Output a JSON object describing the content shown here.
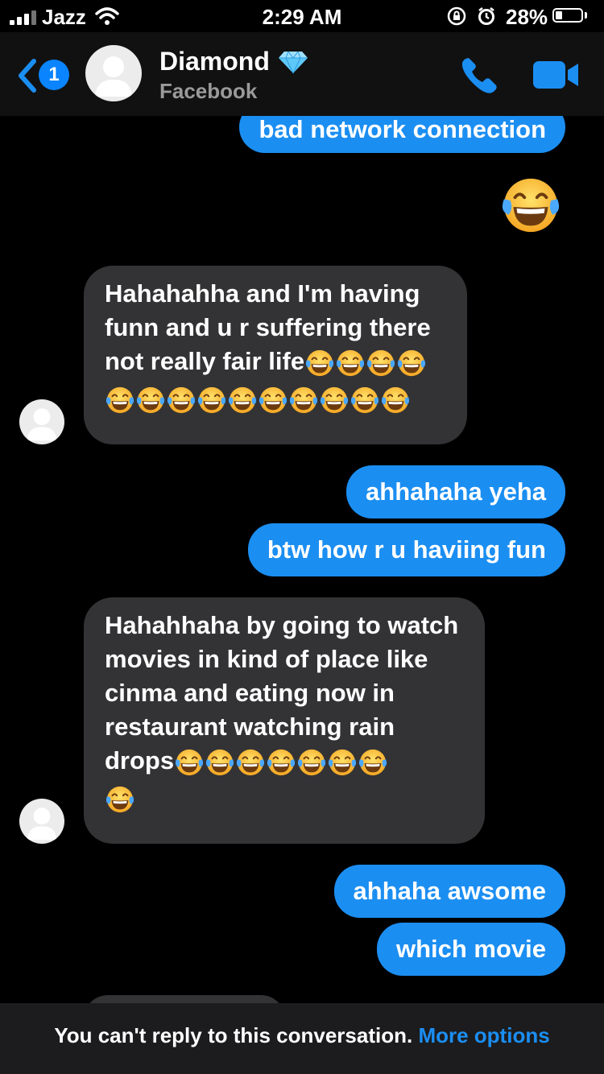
{
  "status_bar": {
    "carrier": "Jazz",
    "time": "2:29 AM",
    "battery_percent": "28%",
    "battery_level": 0.28
  },
  "header": {
    "back_badge": "1",
    "contact_name": "Diamond",
    "subtitle": "Facebook",
    "icons": [
      "back-chevron-icon",
      "diamond-icon",
      "phone-icon",
      "video-camera-icon"
    ]
  },
  "messages": {
    "m1": "bad network connection",
    "m2_emoji": "😂",
    "m3_text": "Hahahahha and I'm having funn and u r suffering there not really fair life",
    "m3_emoji_count": 14,
    "m4": "ahhahaha yeha",
    "m5": "btw how r u haviing fun",
    "m6_text": "Hahahhaha by going to watch movies in kind of place like cinma and eating now in restaurant watching rain drops",
    "m6_emoji_count": 8,
    "m7": "ahhaha awsome",
    "m8": "which movie"
  },
  "footer": {
    "text": "You can't reply to this conversation.",
    "link": "More options"
  },
  "colors": {
    "outgoing_bubble": "#1b8ef2",
    "incoming_bubble": "#333335",
    "header_bg": "#111111",
    "background": "#000000",
    "link": "#1b8ef2"
  }
}
